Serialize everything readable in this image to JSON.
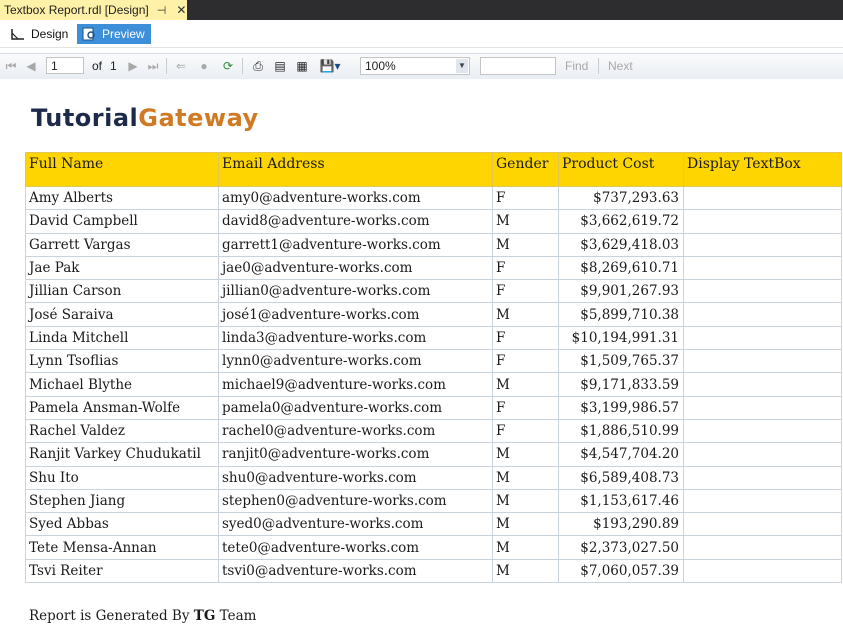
{
  "document_tab": {
    "title": "Textbox Report.rdl [Design]",
    "pin_icon": "pin-icon",
    "close_icon": "close-icon"
  },
  "mode_bar": {
    "design_label": "Design",
    "preview_label": "Preview",
    "active": "Preview"
  },
  "toolbar": {
    "page_current": "1",
    "page_of_label": "of",
    "page_total": "1",
    "zoom": "100%",
    "find_label": "Find",
    "next_label": "Next"
  },
  "report": {
    "logo_part1": "Tutorial",
    "logo_part2": "Gateway",
    "columns": [
      "Full Name",
      "Email Address",
      "Gender",
      "Product Cost",
      "Display TextBox"
    ],
    "rows": [
      [
        "Amy Alberts",
        "amy0@adventure-works.com",
        "F",
        "$737,293.63",
        ""
      ],
      [
        "David Campbell",
        "david8@adventure-works.com",
        "M",
        "$3,662,619.72",
        ""
      ],
      [
        "Garrett Vargas",
        "garrett1@adventure-works.com",
        "M",
        "$3,629,418.03",
        ""
      ],
      [
        "Jae Pak",
        "jae0@adventure-works.com",
        "F",
        "$8,269,610.71",
        ""
      ],
      [
        "Jillian Carson",
        "jillian0@adventure-works.com",
        "F",
        "$9,901,267.93",
        ""
      ],
      [
        "José Saraiva",
        "josé1@adventure-works.com",
        "M",
        "$5,899,710.38",
        ""
      ],
      [
        "Linda Mitchell",
        "linda3@adventure-works.com",
        "F",
        "$10,194,991.31",
        ""
      ],
      [
        "Lynn Tsoflias",
        "lynn0@adventure-works.com",
        "F",
        "$1,509,765.37",
        ""
      ],
      [
        "Michael Blythe",
        "michael9@adventure-works.com",
        "M",
        "$9,171,833.59",
        ""
      ],
      [
        "Pamela Ansman-Wolfe",
        "pamela0@adventure-works.com",
        "F",
        "$3,199,986.57",
        ""
      ],
      [
        "Rachel Valdez",
        "rachel0@adventure-works.com",
        "F",
        "$1,886,510.99",
        ""
      ],
      [
        "Ranjit Varkey Chudukatil",
        "ranjit0@adventure-works.com",
        "M",
        "$4,547,704.20",
        ""
      ],
      [
        "Shu Ito",
        "shu0@adventure-works.com",
        "M",
        "$6,589,408.73",
        ""
      ],
      [
        "Stephen Jiang",
        "stephen0@adventure-works.com",
        "M",
        "$1,153,617.46",
        ""
      ],
      [
        "Syed Abbas",
        "syed0@adventure-works.com",
        "M",
        "$193,290.89",
        ""
      ],
      [
        "Tete Mensa-Annan",
        "tete0@adventure-works.com",
        "M",
        "$2,373,027.50",
        ""
      ],
      [
        "Tsvi Reiter",
        "tsvi0@adventure-works.com",
        "M",
        "$7,060,057.39",
        ""
      ]
    ],
    "footer_prefix": "Report is Generated By ",
    "footer_bold": "TG",
    "footer_suffix": " Team"
  },
  "colors": {
    "header_fill": "#ffd500",
    "preview_active": "#3d8fd9",
    "tab_active": "#fff1a8",
    "logo_dark": "#1d2a4a",
    "logo_orange": "#d07a23"
  }
}
